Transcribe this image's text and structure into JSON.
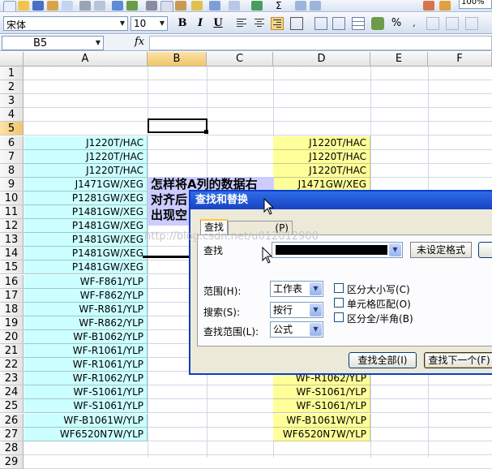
{
  "toolbar": {
    "font_name": "宋体",
    "font_size": "10",
    "bold_label": "B",
    "italic_label": "I",
    "underline_label": "U",
    "zoom": "100%",
    "percent_label": "%"
  },
  "formula_bar": {
    "name_box": "B5",
    "fx_label": "fx"
  },
  "columns": [
    "A",
    "B",
    "C",
    "D",
    "E",
    "F"
  ],
  "rows": [
    "1",
    "2",
    "3",
    "4",
    "5",
    "6",
    "7",
    "8",
    "9",
    "10",
    "11",
    "12",
    "13",
    "14",
    "15",
    "16",
    "17",
    "18",
    "19",
    "20",
    "21",
    "22",
    "23",
    "24",
    "25",
    "26",
    "27",
    "28",
    "29"
  ],
  "column_a": [
    "J1220T/HAC",
    "J1220T/HAC",
    "J1220T/HAC",
    "J1471GW/XEG",
    "P1281GW/XEG",
    "P1481GW/XEG",
    "P1481GW/XEG",
    "P1481GW/XEG",
    "P1481GW/XEG",
    "P1481GW/XEG",
    "WF-F861/YLP",
    "WF-F862/YLP",
    "WF-R861/YLP",
    "WF-R862/YLP",
    "WF-B1062/YLP",
    "WF-R1061/YLP",
    "WF-R1061/YLP",
    "WF-R1062/YLP",
    "WF-S1061/YLP",
    "WF-S1061/YLP",
    "WF-B1061W/YLP",
    "WF6520N7W/YLP"
  ],
  "column_d": [
    "J1220T/HAC",
    "J1220T/HAC",
    "J1220T/HAC",
    "J1471GW/XEG",
    "",
    "",
    "",
    "",
    "",
    "",
    "",
    "",
    "",
    "",
    "",
    "",
    "",
    "WF-R1062/YLP",
    "WF-S1061/YLP",
    "WF-S1061/YLP",
    "WF-B1061W/YLP",
    "WF6520N7W/YLP"
  ],
  "note_lines": [
    "怎样将A列的数据右",
    "对齐后",
    "出现空"
  ],
  "watermark": "http://blog.csdn.net/u012012900",
  "dialog": {
    "title": "查找和替换",
    "tab_find": "查找",
    "tab_replace_hint": "(P)",
    "find_label": "查找",
    "format_status": "未设定格式",
    "scope_label": "范围(H):",
    "scope_value": "工作表",
    "search_label": "搜索(S):",
    "search_value": "按行",
    "lookin_label": "查找范围(L):",
    "lookin_value": "公式",
    "opt_case": "区分大小写(C)",
    "opt_cell": "单元格匹配(O)",
    "opt_width": "区分全/半角(B)",
    "find_all": "查找全部(I)",
    "find_next": "查找下一个(F)"
  },
  "colors": {
    "column_a_fill": "#ccffff",
    "column_d_fill": "#ffff99",
    "note_fill": "#ccccff",
    "dialog_title": "#1f52d6"
  }
}
